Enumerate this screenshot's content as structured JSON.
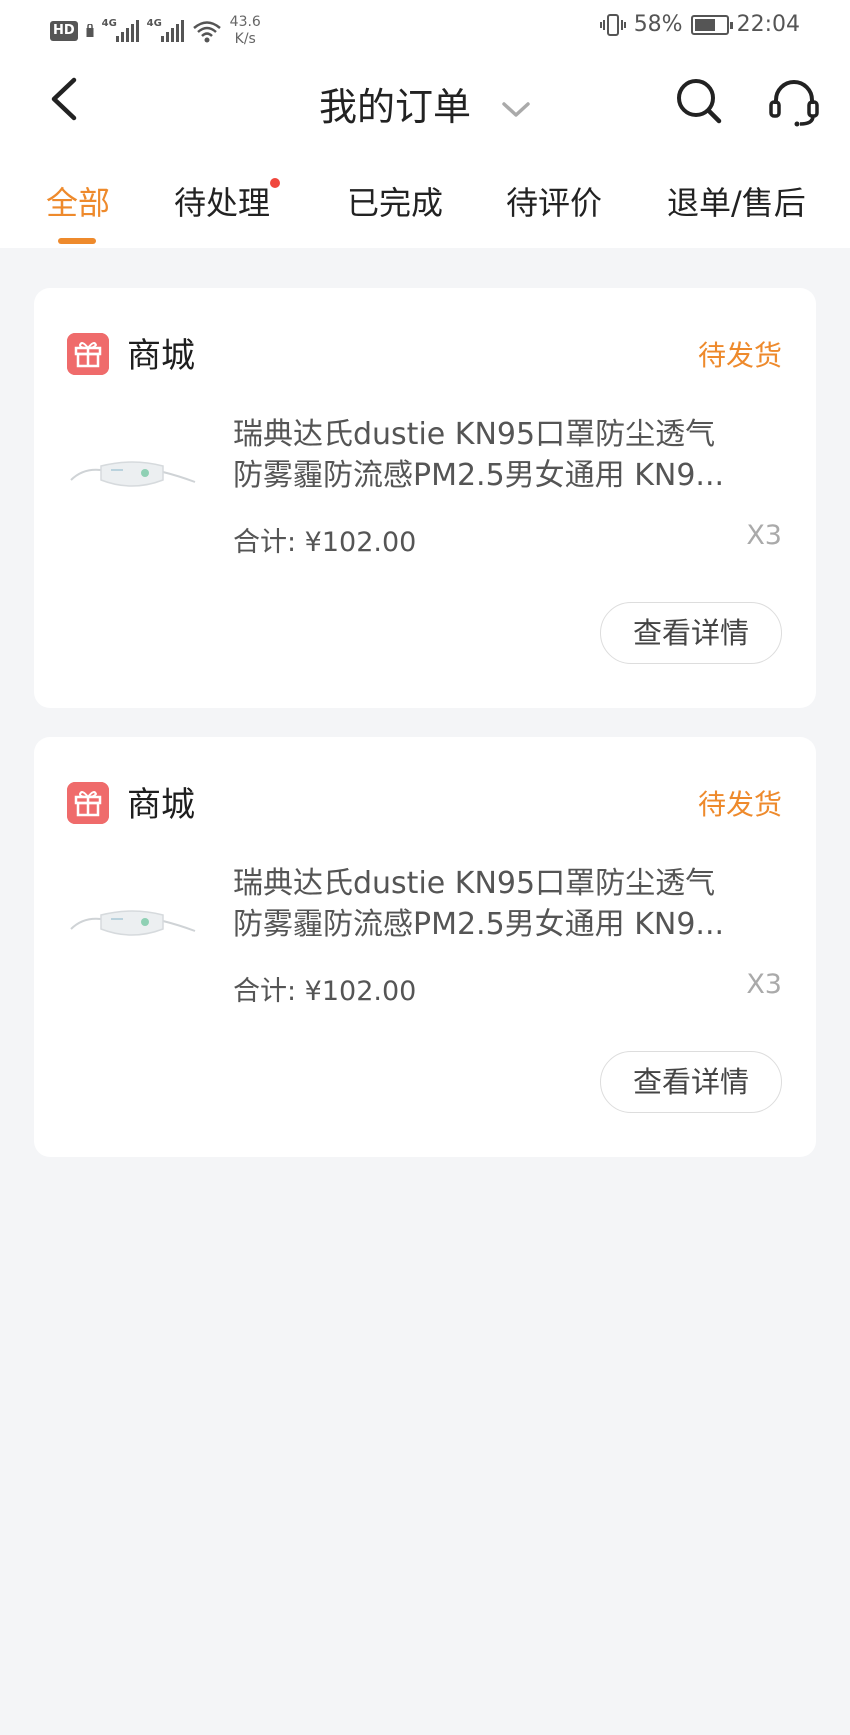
{
  "status_bar": {
    "hd": "HD",
    "sig1": "4G",
    "sig2": "4G",
    "speed_value": "43.6",
    "speed_unit": "K/s",
    "battery_pct": "58%",
    "battery_level": 0.58,
    "time": "22:04"
  },
  "header": {
    "title": "我的订单"
  },
  "tabs": [
    {
      "label": "全部",
      "active": true
    },
    {
      "label": "待处理",
      "has_dot": true
    },
    {
      "label": "已完成"
    },
    {
      "label": "待评价"
    },
    {
      "label": "退单/售后"
    }
  ],
  "orders": [
    {
      "store": "商城",
      "status": "待发货",
      "title_line1": "瑞典达氏dustie KN95口罩防尘透气",
      "title_line2": "防雾霾防流感PM2.5男女通用 KN9...",
      "total": "合计: ¥102.00",
      "qty": "X3",
      "detail_label": "查看详情"
    },
    {
      "store": "商城",
      "status": "待发货",
      "title_line1": "瑞典达氏dustie KN95口罩防尘透气",
      "title_line2": "防雾霾防流感PM2.5男女通用 KN9...",
      "total": "合计: ¥102.00",
      "qty": "X3",
      "detail_label": "查看详情"
    }
  ],
  "colors": {
    "accent": "#ee8a2c",
    "store_icon": "#ef6b6b",
    "tab_dot": "#f0463c",
    "background": "#f4f5f7"
  }
}
